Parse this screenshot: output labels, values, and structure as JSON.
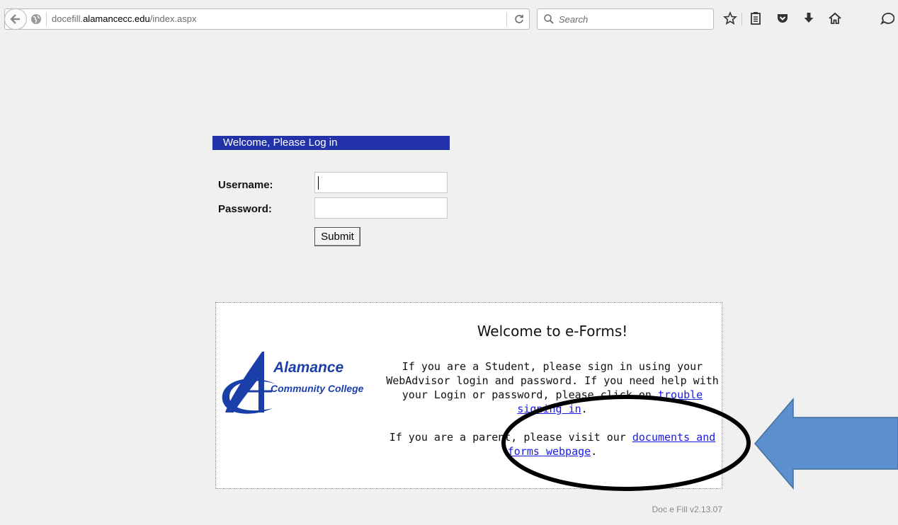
{
  "browser": {
    "url": {
      "prefix": "docefill.",
      "host": "alamancecc.edu",
      "path": "/index.aspx"
    },
    "search_placeholder": "Search",
    "icons": [
      "back-arrow-icon",
      "globe-icon",
      "reload-icon",
      "search-icon",
      "bookmark-star-icon",
      "reading-list-icon",
      "pocket-icon",
      "download-icon",
      "home-icon",
      "chat-icon"
    ]
  },
  "login": {
    "header": "Welcome, Please Log in",
    "username_label": "Username:",
    "password_label": "Password:",
    "submit_label": "Submit"
  },
  "welcome": {
    "title": "Welcome to e-Forms!",
    "student_text_1": "If you are a Student, please sign in using your WebAdvisor login and password. If you need help with your Login or password, please click on ",
    "trouble_link": "trouble signing in",
    "student_text_2": ".",
    "parent_text_1": "If you are a parent, please visit our ",
    "documents_link": "documents and forms webpage",
    "parent_text_2": "."
  },
  "logo": {
    "line1": "Alamance",
    "line2": "Community College",
    "color": "#1b3fa8"
  },
  "version": "Doc e Fill v2.13.07",
  "annotation": {
    "arrow_color": "#5b8fcd",
    "ellipse_color": "#000000"
  }
}
